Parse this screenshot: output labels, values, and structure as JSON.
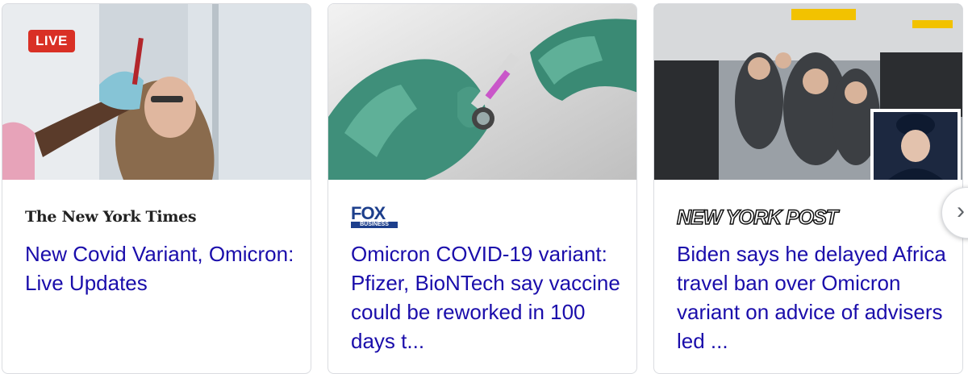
{
  "cards": [
    {
      "badge": "LIVE",
      "source": "The New York Times",
      "headline": "New Covid Variant, Omicron: Live Updates"
    },
    {
      "source_top": "FOX",
      "source_bottom": "BUSINESS",
      "headline": "Omicron COVID-19 variant: Pfizer, BioNTech say vaccine could be reworked in 100 days t..."
    },
    {
      "source": "NEW YORK POST",
      "headline": "Biden says he delayed Africa travel ban over Omicron variant on advice of advisers led ..."
    }
  ],
  "carousel": {
    "next_icon": "chevron-right-icon",
    "next_glyph": "›"
  },
  "colors": {
    "headline": "#1a0dab",
    "live_badge": "#d93025",
    "fox_blue": "#1d3f8c"
  }
}
